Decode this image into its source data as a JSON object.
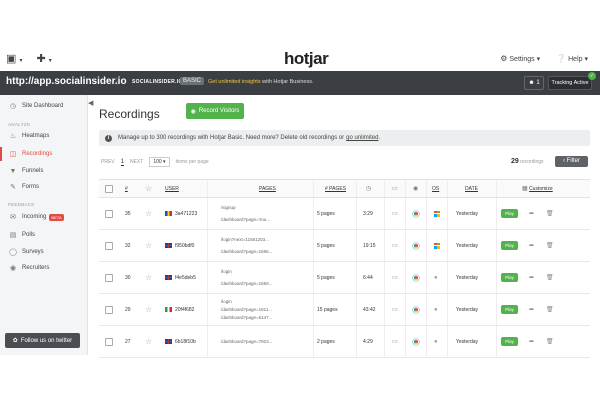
{
  "topnav": {
    "home_icon": "building-icon",
    "add_icon": "plus-icon",
    "logo": "hotjar",
    "settings_label": "Settings",
    "help_label": "Help"
  },
  "sitebar": {
    "url": "http://app.socialinsider.io",
    "site_name": "SOCIALINSIDER.IO",
    "plan": "BASIC",
    "upsell_link": "Get unlimited insights",
    "upsell_text": "with Hotjar Business.",
    "users_count": "1",
    "tracking_label": "Tracking Active"
  },
  "sidebar": {
    "dashboard": "Site Dashboard",
    "analyze_label": "ANALYZE",
    "heatmaps": "Heatmaps",
    "recordings": "Recordings",
    "funnels": "Funnels",
    "forms": "Forms",
    "feedback_label": "FEEDBACK",
    "incoming": "Incoming",
    "incoming_badge": "BETA",
    "polls": "Polls",
    "surveys": "Surveys",
    "recruiters": "Recruiters",
    "twitter": "Follow us on twitter"
  },
  "main": {
    "title": "Recordings",
    "record_button": "Record Visitors",
    "info_text": "Manage up to 300 recordings with Hotjar Basic. Need more? Delete old recordings or",
    "info_link": "go unlimited",
    "info_tail": ".",
    "prev": "PREV",
    "page": "1",
    "next": "NEXT",
    "per_page": "100",
    "per_page_label": "items per page",
    "count": "29",
    "count_label": "recordings",
    "filter_label": "Filter"
  },
  "table": {
    "headers": {
      "num": "#",
      "user": "USER",
      "pages": "PAGES",
      "num_pages": "# PAGES",
      "os": "OS",
      "date": "DATE",
      "customize": "Customize"
    },
    "rows": [
      {
        "num": "35",
        "flag": "ro",
        "user": "3a471223",
        "pages": [
          "/signup",
          "/dashboard?page=You..."
        ],
        "num_pages": "5 pages",
        "duration": "3:29",
        "os": "windows",
        "date": "Yesterday",
        "play": "Play"
      },
      {
        "num": "32",
        "flag": "uk",
        "user": "f950bdf0",
        "pages": [
          "/login?next=11561203...",
          "/dashboard?page=1656..."
        ],
        "num_pages": "5 pages",
        "duration": "19:15",
        "os": "windows",
        "date": "Yesterday",
        "play": "Play"
      },
      {
        "num": "30",
        "flag": "uk",
        "user": "f4e5deb5",
        "pages": [
          "/login",
          "/dashboard?page=1659..."
        ],
        "num_pages": "5 pages",
        "duration": "6:44",
        "os": "apple",
        "date": "Yesterday",
        "play": "Play"
      },
      {
        "num": "29",
        "flag": "it",
        "user": "20f4f682",
        "pages": [
          "/login",
          "/dashboard?page=1811...",
          "/dashboard?page=6147..."
        ],
        "num_pages": "15 pages",
        "duration": "43:42",
        "os": "apple",
        "date": "Yesterday",
        "play": "Play"
      },
      {
        "num": "27",
        "flag": "uk",
        "user": "6b18f10b",
        "pages": [
          "/dashboard?page=7923..."
        ],
        "num_pages": "2 pages",
        "duration": "4:29",
        "os": "apple",
        "date": "Yesterday",
        "play": "Play"
      }
    ]
  },
  "colors": {
    "accent_green": "#52b24c",
    "active_red": "#e24b3f",
    "sitebar_bg": "#3b3f44"
  }
}
